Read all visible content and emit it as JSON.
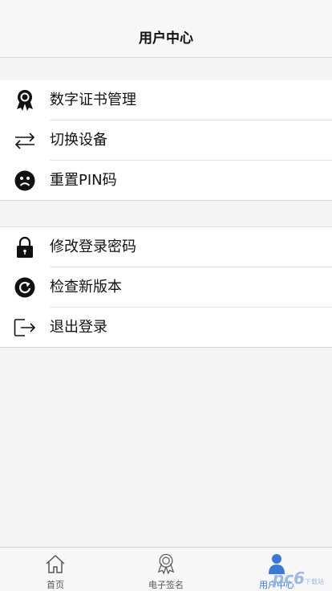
{
  "header": {
    "title": "用户中心"
  },
  "group1": [
    {
      "label": "数字证书管理",
      "icon": "certificate-ribbon-icon"
    },
    {
      "label": "切换设备",
      "icon": "switch-arrows-icon"
    },
    {
      "label": "重置PIN码",
      "icon": "sad-face-icon"
    }
  ],
  "group2": [
    {
      "label": "修改登录密码",
      "icon": "lock-icon"
    },
    {
      "label": "检查新版本",
      "icon": "refresh-icon"
    },
    {
      "label": "退出登录",
      "icon": "logout-icon"
    }
  ],
  "tabbar": {
    "tabs": [
      {
        "label": "首页",
        "icon": "home-icon",
        "active": false
      },
      {
        "label": "电子签名",
        "icon": "certificate-ribbon-icon",
        "active": false
      },
      {
        "label": "用户中心",
        "icon": "user-icon",
        "active": true
      }
    ]
  },
  "watermark": {
    "brand": "pc6",
    "sub": "下载站"
  },
  "colors": {
    "active": "#3a78d8",
    "background": "#f4f4f4"
  }
}
